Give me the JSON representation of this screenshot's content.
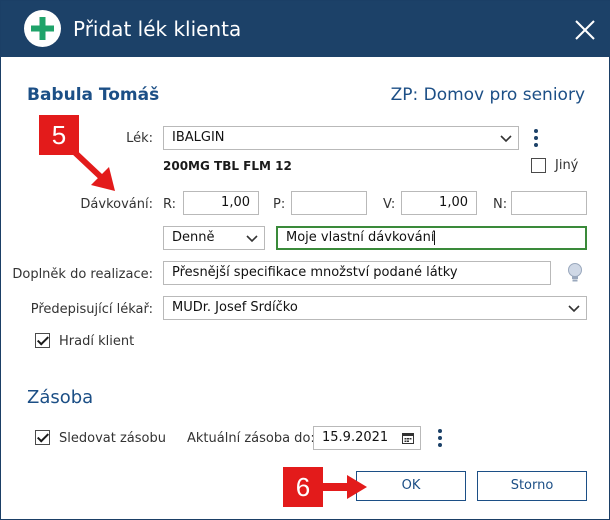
{
  "window": {
    "title": "Přidat lék klienta",
    "close_icon": "close-icon",
    "add_icon": "plus-circle-icon"
  },
  "header": {
    "client_name": "Babula Tomáš",
    "zp": "ZP: Domov pro seniory"
  },
  "form": {
    "lek_label": "Lék:",
    "lek_value": "IBALGIN",
    "lek_detail": "200MG TBL FLM 12",
    "jiny_label": "Jiný",
    "jiny_checked": false,
    "davkovani_label": "Dávkování:",
    "r_label": "R:",
    "r_value": "1,00",
    "p_label": "P:",
    "p_value": "",
    "v_label": "V:",
    "v_value": "1,00",
    "n_label": "N:",
    "n_value": "",
    "frequency_value": "Denně",
    "custom_dosage_value": "Moje vlastní dávkování",
    "doplnek_label": "Doplněk do realizace:",
    "doplnek_value": "Přesnější specifikace množství podané látky",
    "lekar_label": "Předepisující lékař:",
    "lekar_value": "MUDr. Josef Srdíčko",
    "hradi_label": "Hradí klient",
    "hradi_checked": true
  },
  "zasoba": {
    "title": "Zásoba",
    "sledovat_label": "Sledovat zásobu",
    "sledovat_checked": true,
    "aktualni_label": "Aktuální zásoba do:",
    "aktualni_value": "15.9.2021"
  },
  "buttons": {
    "ok": "OK",
    "storno": "Storno"
  },
  "annotations": {
    "badge_5": "5",
    "badge_6": "6"
  },
  "colors": {
    "titlebar": "#1c4168",
    "accent": "#1c4f86",
    "plus": "#1fa36a",
    "badge": "#e31b1b",
    "active_border": "#3a8a3a"
  }
}
